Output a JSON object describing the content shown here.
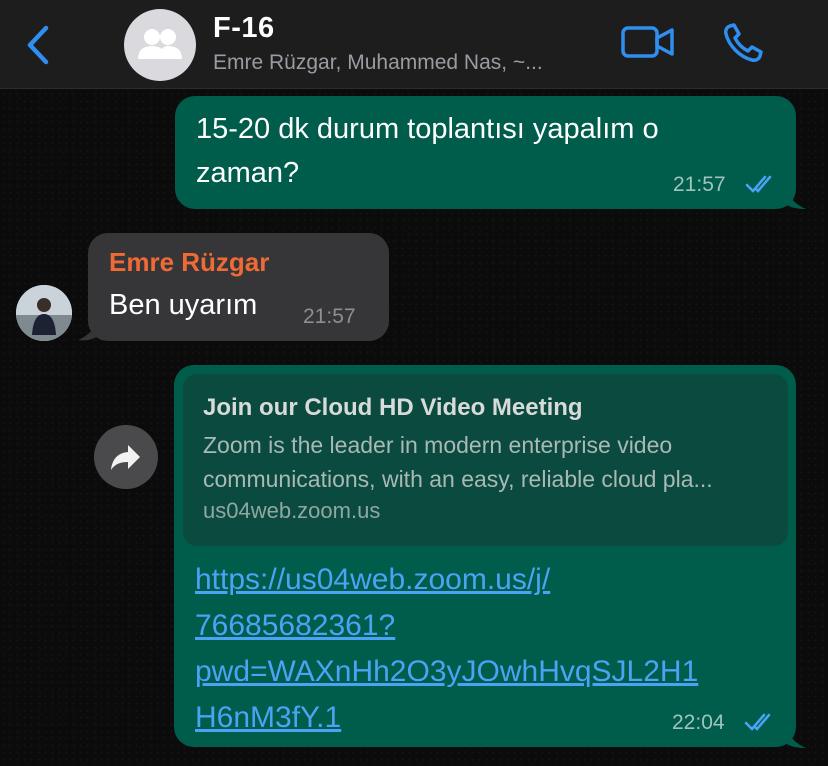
{
  "header": {
    "title": "F-16",
    "subtitle": "Emre Rüzgar, Muhammed Nas, ~..."
  },
  "messages": [
    {
      "direction": "outgoing",
      "lines": [
        "15-20 dk durum toplantısı yapalım o",
        "zaman?"
      ],
      "time": "21:57"
    },
    {
      "direction": "incoming",
      "sender": "Emre Rüzgar",
      "text": "Ben uyarım",
      "time": "21:57"
    },
    {
      "direction": "outgoing",
      "preview": {
        "title": "Join our Cloud HD Video Meeting",
        "description_lines": [
          "Zoom is the leader in modern enterprise video",
          "communications, with an easy, reliable cloud pla..."
        ],
        "host": "us04web.zoom.us"
      },
      "link_lines": [
        "https://us04web.zoom.us/j/",
        "76685682361?",
        "pwd=WAXnHh2O3yJOwhHvqSJL2H1",
        "H6nM3fY.1"
      ],
      "time": "22:04"
    }
  ],
  "colors": {
    "outgoing_bubble": "#005c4b",
    "incoming_bubble": "#363638",
    "sender_name": "#f06a35",
    "link": "#4aa3f5",
    "accent": "#2f8ff0"
  },
  "icons": {
    "back": "chevron-left-icon",
    "group_avatar": "group-icon",
    "video": "video-camera-icon",
    "call": "phone-icon",
    "forward": "forward-arrow-icon",
    "read_receipt": "double-check-icon"
  }
}
